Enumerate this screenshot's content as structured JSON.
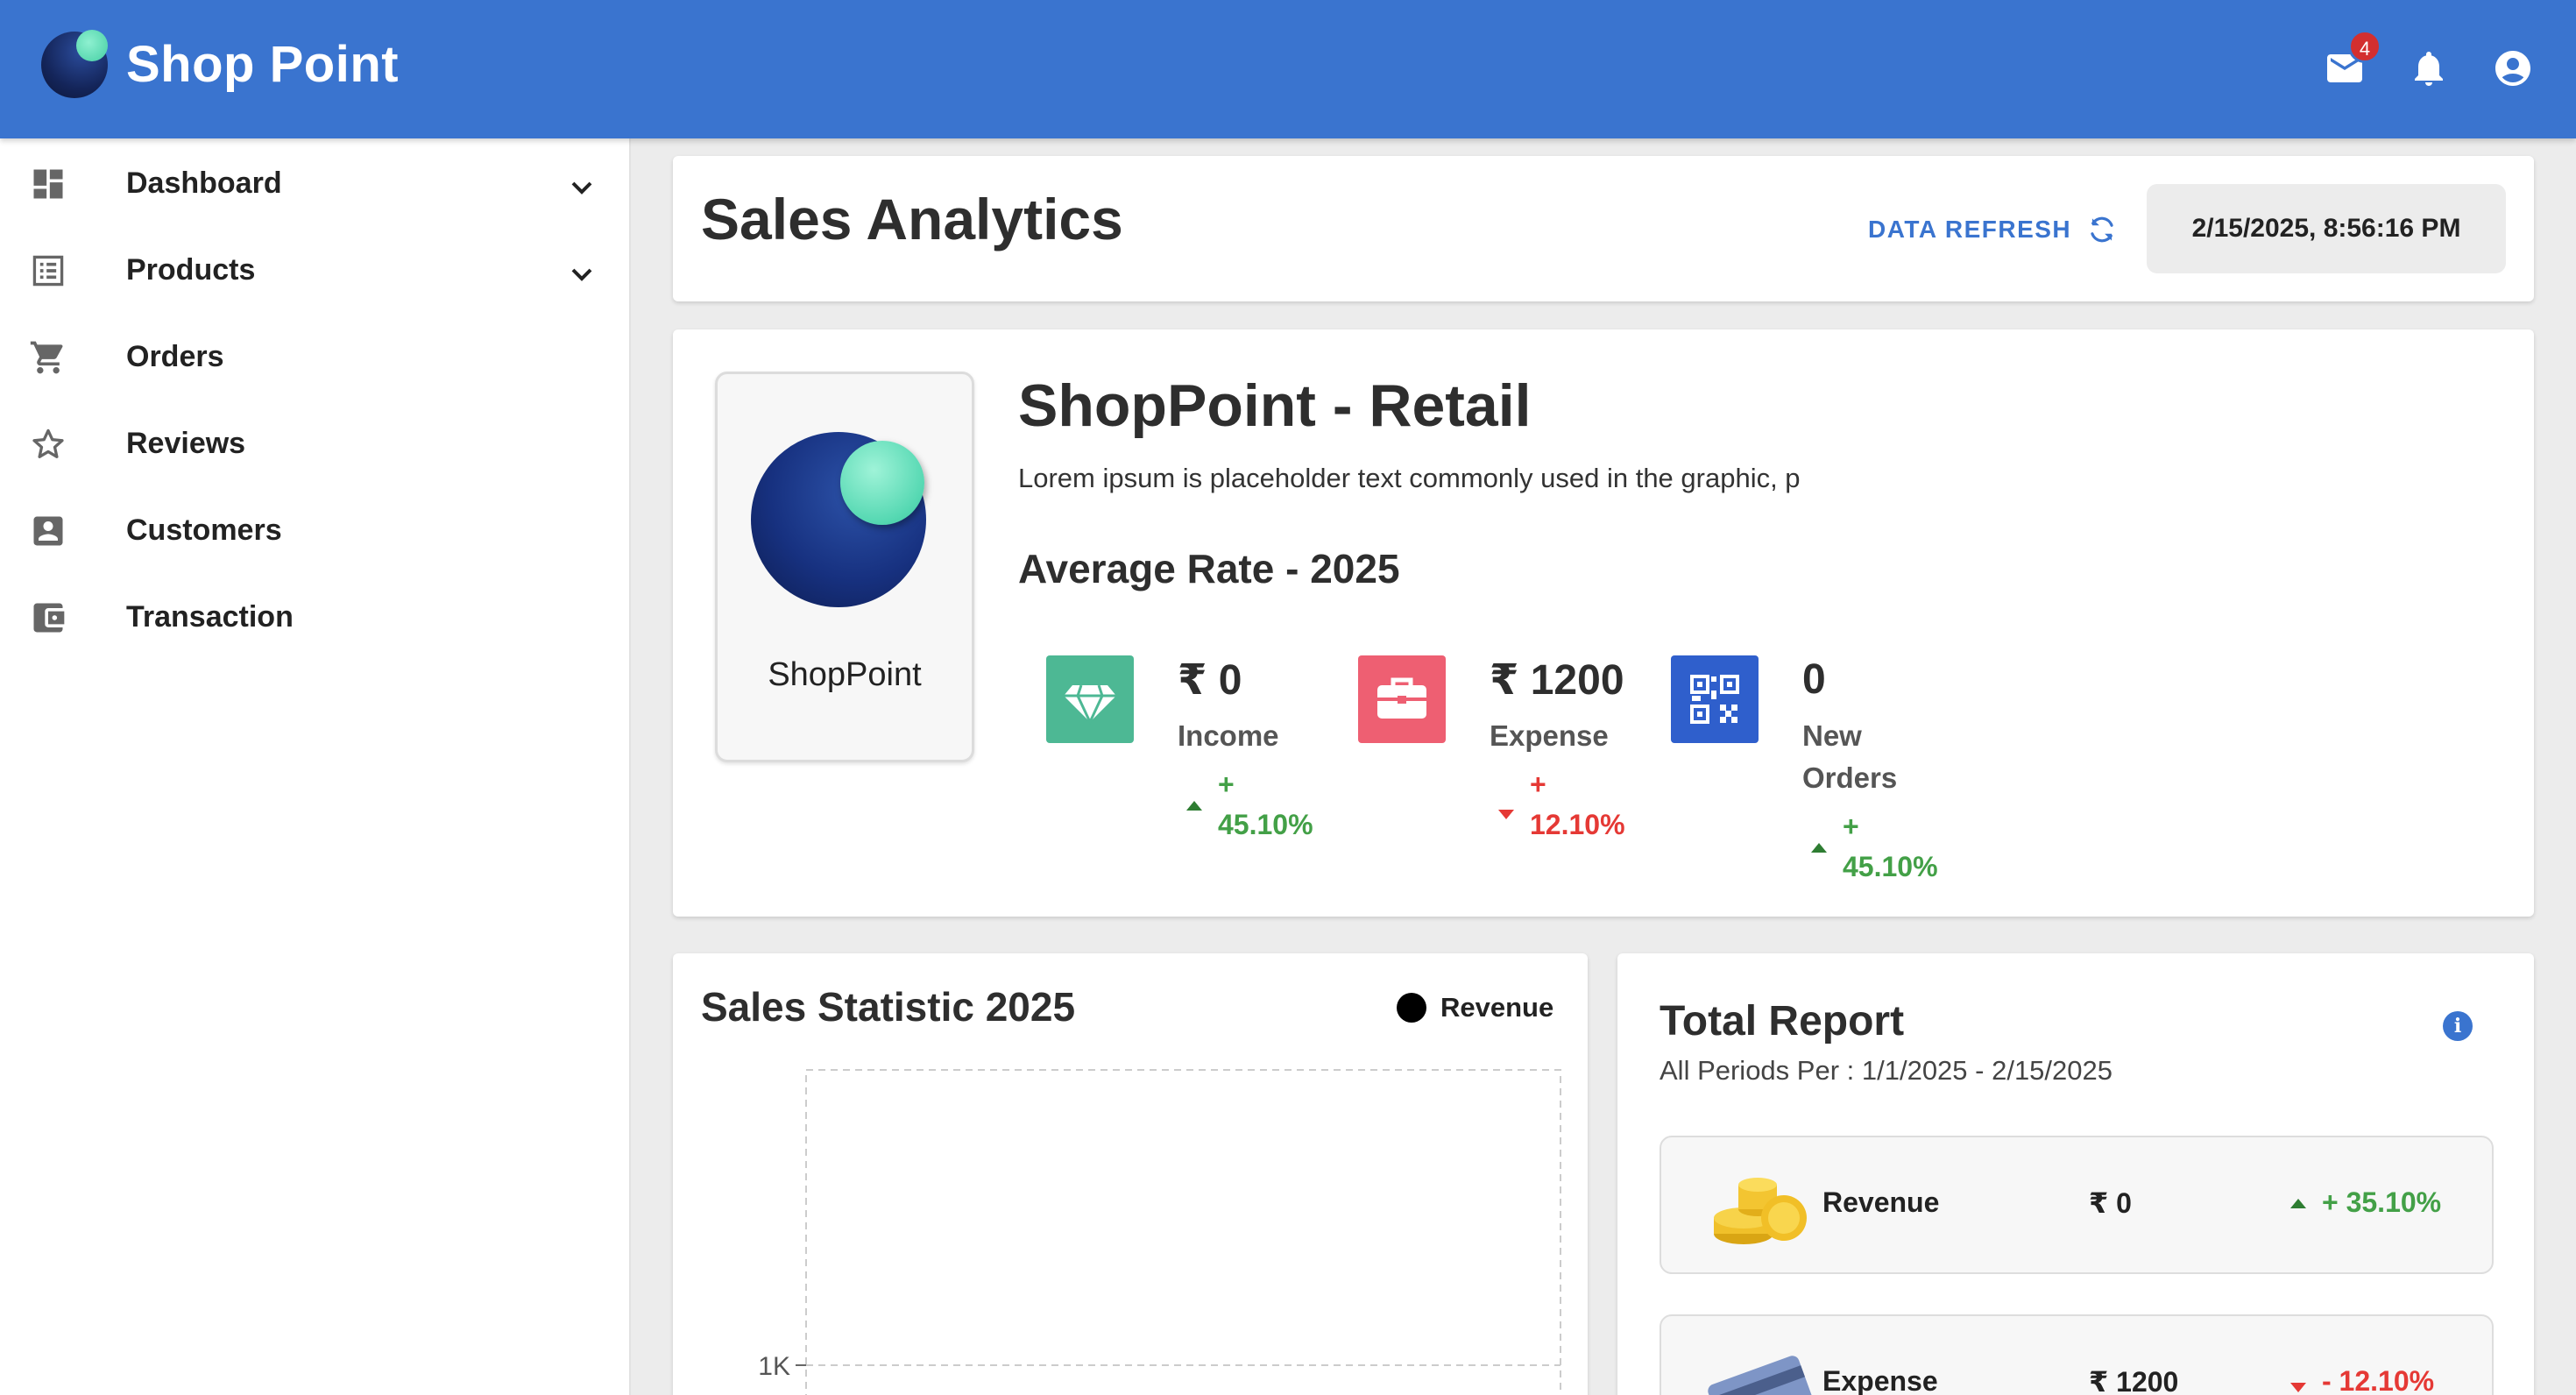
{
  "app": {
    "brand": "Shop Point",
    "mail_badge": "4",
    "colors": {
      "primary": "#3a74cf",
      "success": "#43a047",
      "danger": "#e53935"
    }
  },
  "sidebar": {
    "items": [
      {
        "label": "Dashboard",
        "icon": "dashboard-icon",
        "expandable": true
      },
      {
        "label": "Products",
        "icon": "list-icon",
        "expandable": true
      },
      {
        "label": "Orders",
        "icon": "cart-icon",
        "expandable": false
      },
      {
        "label": "Reviews",
        "icon": "star-icon",
        "expandable": false
      },
      {
        "label": "Customers",
        "icon": "account-box-icon",
        "expandable": false
      },
      {
        "label": "Transaction",
        "icon": "wallet-icon",
        "expandable": false
      }
    ]
  },
  "header": {
    "title": "Sales Analytics",
    "refresh_label": "DATA REFRESH",
    "datetime": "2/15/2025, 8:56:16 PM"
  },
  "store": {
    "logo_label": "ShopPoint",
    "name": "ShopPoint - Retail",
    "description": "Lorem ipsum is placeholder text commonly used in the graphic, p",
    "avg_rate_title": "Average Rate - 2025",
    "stats": [
      {
        "value": "₹ 0",
        "label": "Income",
        "change_sign": "+",
        "change": "45.10%",
        "trend": "up",
        "icon": "diamond-icon",
        "color": "#4db894"
      },
      {
        "value": "₹ 1200",
        "label": "Expense",
        "change_sign": "+",
        "change": "12.10%",
        "trend": "down",
        "icon": "briefcase-icon",
        "color": "#ee5f72"
      },
      {
        "value": "0",
        "label": "New Orders",
        "label_line1": "New",
        "label_line2": "Orders",
        "change_sign": "+",
        "change": "45.10%",
        "trend": "up",
        "icon": "qr-code-icon",
        "color": "#2f5fcc"
      }
    ]
  },
  "sales_chart": {
    "title": "Sales Statistic 2025",
    "legend": "Revenue"
  },
  "chart_data": {
    "type": "line",
    "title": "Sales Statistic 2025",
    "series": [
      {
        "name": "Revenue",
        "values": []
      }
    ],
    "ytick_labels": [
      "1K"
    ],
    "grid": true,
    "legend_position": "top-right"
  },
  "report": {
    "title": "Total Report",
    "subtitle": "All Periods Per : 1/1/2025 - 2/15/2025",
    "rows": [
      {
        "label": "Revenue",
        "value": "₹ 0",
        "change": "+ 35.10%",
        "trend": "up",
        "icon": "coins-icon"
      },
      {
        "label": "Expense",
        "value": "₹ 1200",
        "change": "- 12.10%",
        "trend": "down",
        "icon": "credit-card-icon"
      }
    ]
  }
}
